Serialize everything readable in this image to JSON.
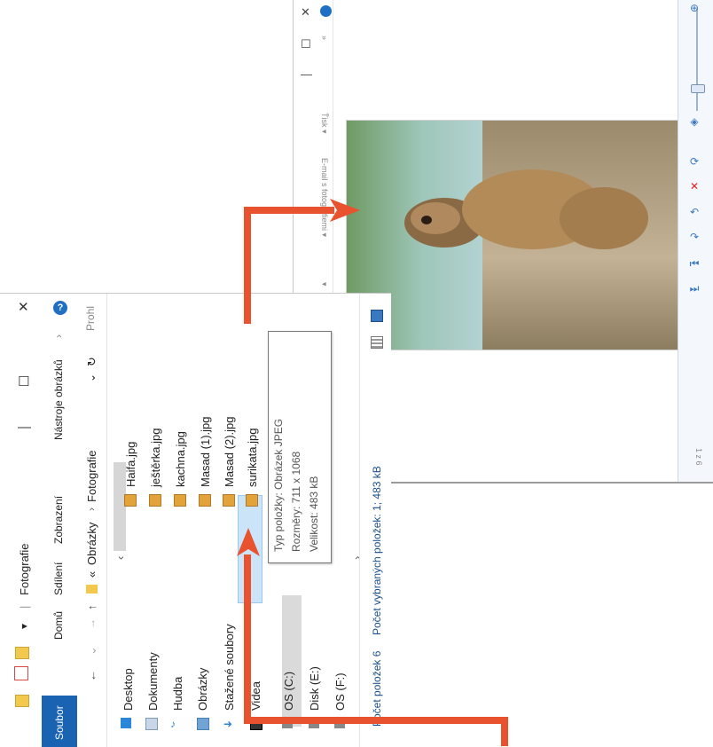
{
  "viewer": {
    "toolbar_labels": [
      "Ťisk ▾",
      "E-mail s fotografiemi ▾",
      "▾"
    ],
    "chevron": "»",
    "ctrl_min": "—",
    "ctrl_max": "☐",
    "ctrl_close": "✕",
    "page_indicator": "1 z 6",
    "bottom_icons": [
      "zoom-in-icon",
      "zoom-slider",
      "fit-icon",
      "rotate-icon",
      "delete-icon",
      "rotate-left-icon",
      "rotate-right-icon",
      "previous-icon",
      "slideshow-icon",
      "next-icon"
    ]
  },
  "explorer": {
    "title": "Fotografie",
    "qat_dropdown": "▾",
    "separator": "|",
    "ctrl_min": "—",
    "ctrl_max": "☐",
    "ctrl_close": "✕",
    "help": "?",
    "ribbon_tabs": [
      "Soubor",
      "Domů",
      "Sdílení",
      "Zobrazení",
      "Nástroje obrázků"
    ],
    "ribbon_chevron": "›",
    "address": {
      "back": "←",
      "forward": "→",
      "recent": "⌄",
      "up": "↑",
      "prefix": "«",
      "crumbs": [
        "Obrázky",
        "Fotografie"
      ],
      "sep": "›",
      "dropdown": "⌄",
      "refresh": "↻",
      "search_placeholder": "Prohl"
    },
    "nav": [
      "Desktop",
      "Dokumenty",
      "Hudba",
      "Obrázky",
      "Stažené soubory",
      "Videa",
      "OS (C:)",
      "Disk (E:)",
      "OS (F:)"
    ],
    "files": [
      "Haifa.jpg",
      "ještěrka.jpg",
      "kachna.jpg",
      "Masad (1).jpg",
      "Masad (2).jpg",
      "surikata.jpg"
    ],
    "tooltip": [
      "Typ položky: Obrázek JPEG",
      "Rozměry: 711 x 1068",
      "Velikost: 483 kB"
    ],
    "scroll_left": "‹",
    "scroll_right": "›",
    "status": {
      "count": "Počet položek 6",
      "selected": "Počet vybraných položek: 1; 483 kB"
    }
  },
  "colors": {
    "accent": "#1a63b3",
    "arrow": "#e8522f",
    "selection": "#cce4f7"
  }
}
